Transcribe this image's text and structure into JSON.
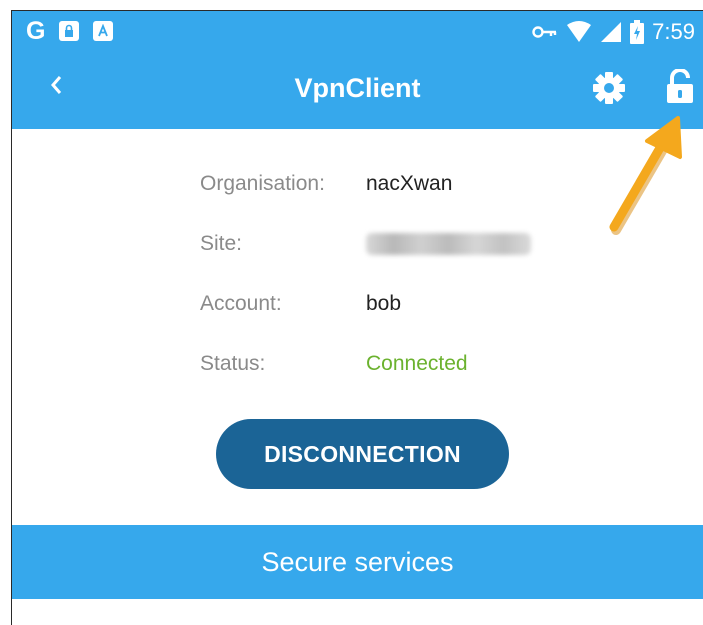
{
  "status_bar": {
    "left_letter": "G",
    "time": "7:59",
    "icons": [
      "lock-notification-icon",
      "a-notification-icon",
      "vpn-key-icon",
      "wifi-icon",
      "signal-icon",
      "battery-icon"
    ]
  },
  "app_bar": {
    "title": "VpnClient",
    "back_icon": "chevron-left-icon",
    "settings_icon": "gear-icon",
    "lock_icon": "unlocked-padlock-icon"
  },
  "info": {
    "organisation": {
      "label": "Organisation:",
      "value": "nacXwan"
    },
    "site": {
      "label": "Site:",
      "value": ""
    },
    "account": {
      "label": "Account:",
      "value": "bob"
    },
    "status": {
      "label": "Status:",
      "value": "Connected"
    }
  },
  "actions": {
    "disconnect_label": "DISCONNECTION"
  },
  "sections": {
    "secure_services": "Secure services"
  },
  "colors": {
    "primary": "#36a8ec",
    "button": "#1b6496",
    "status_connected": "#6bb22e",
    "annotation_arrow": "#f4a81d"
  }
}
